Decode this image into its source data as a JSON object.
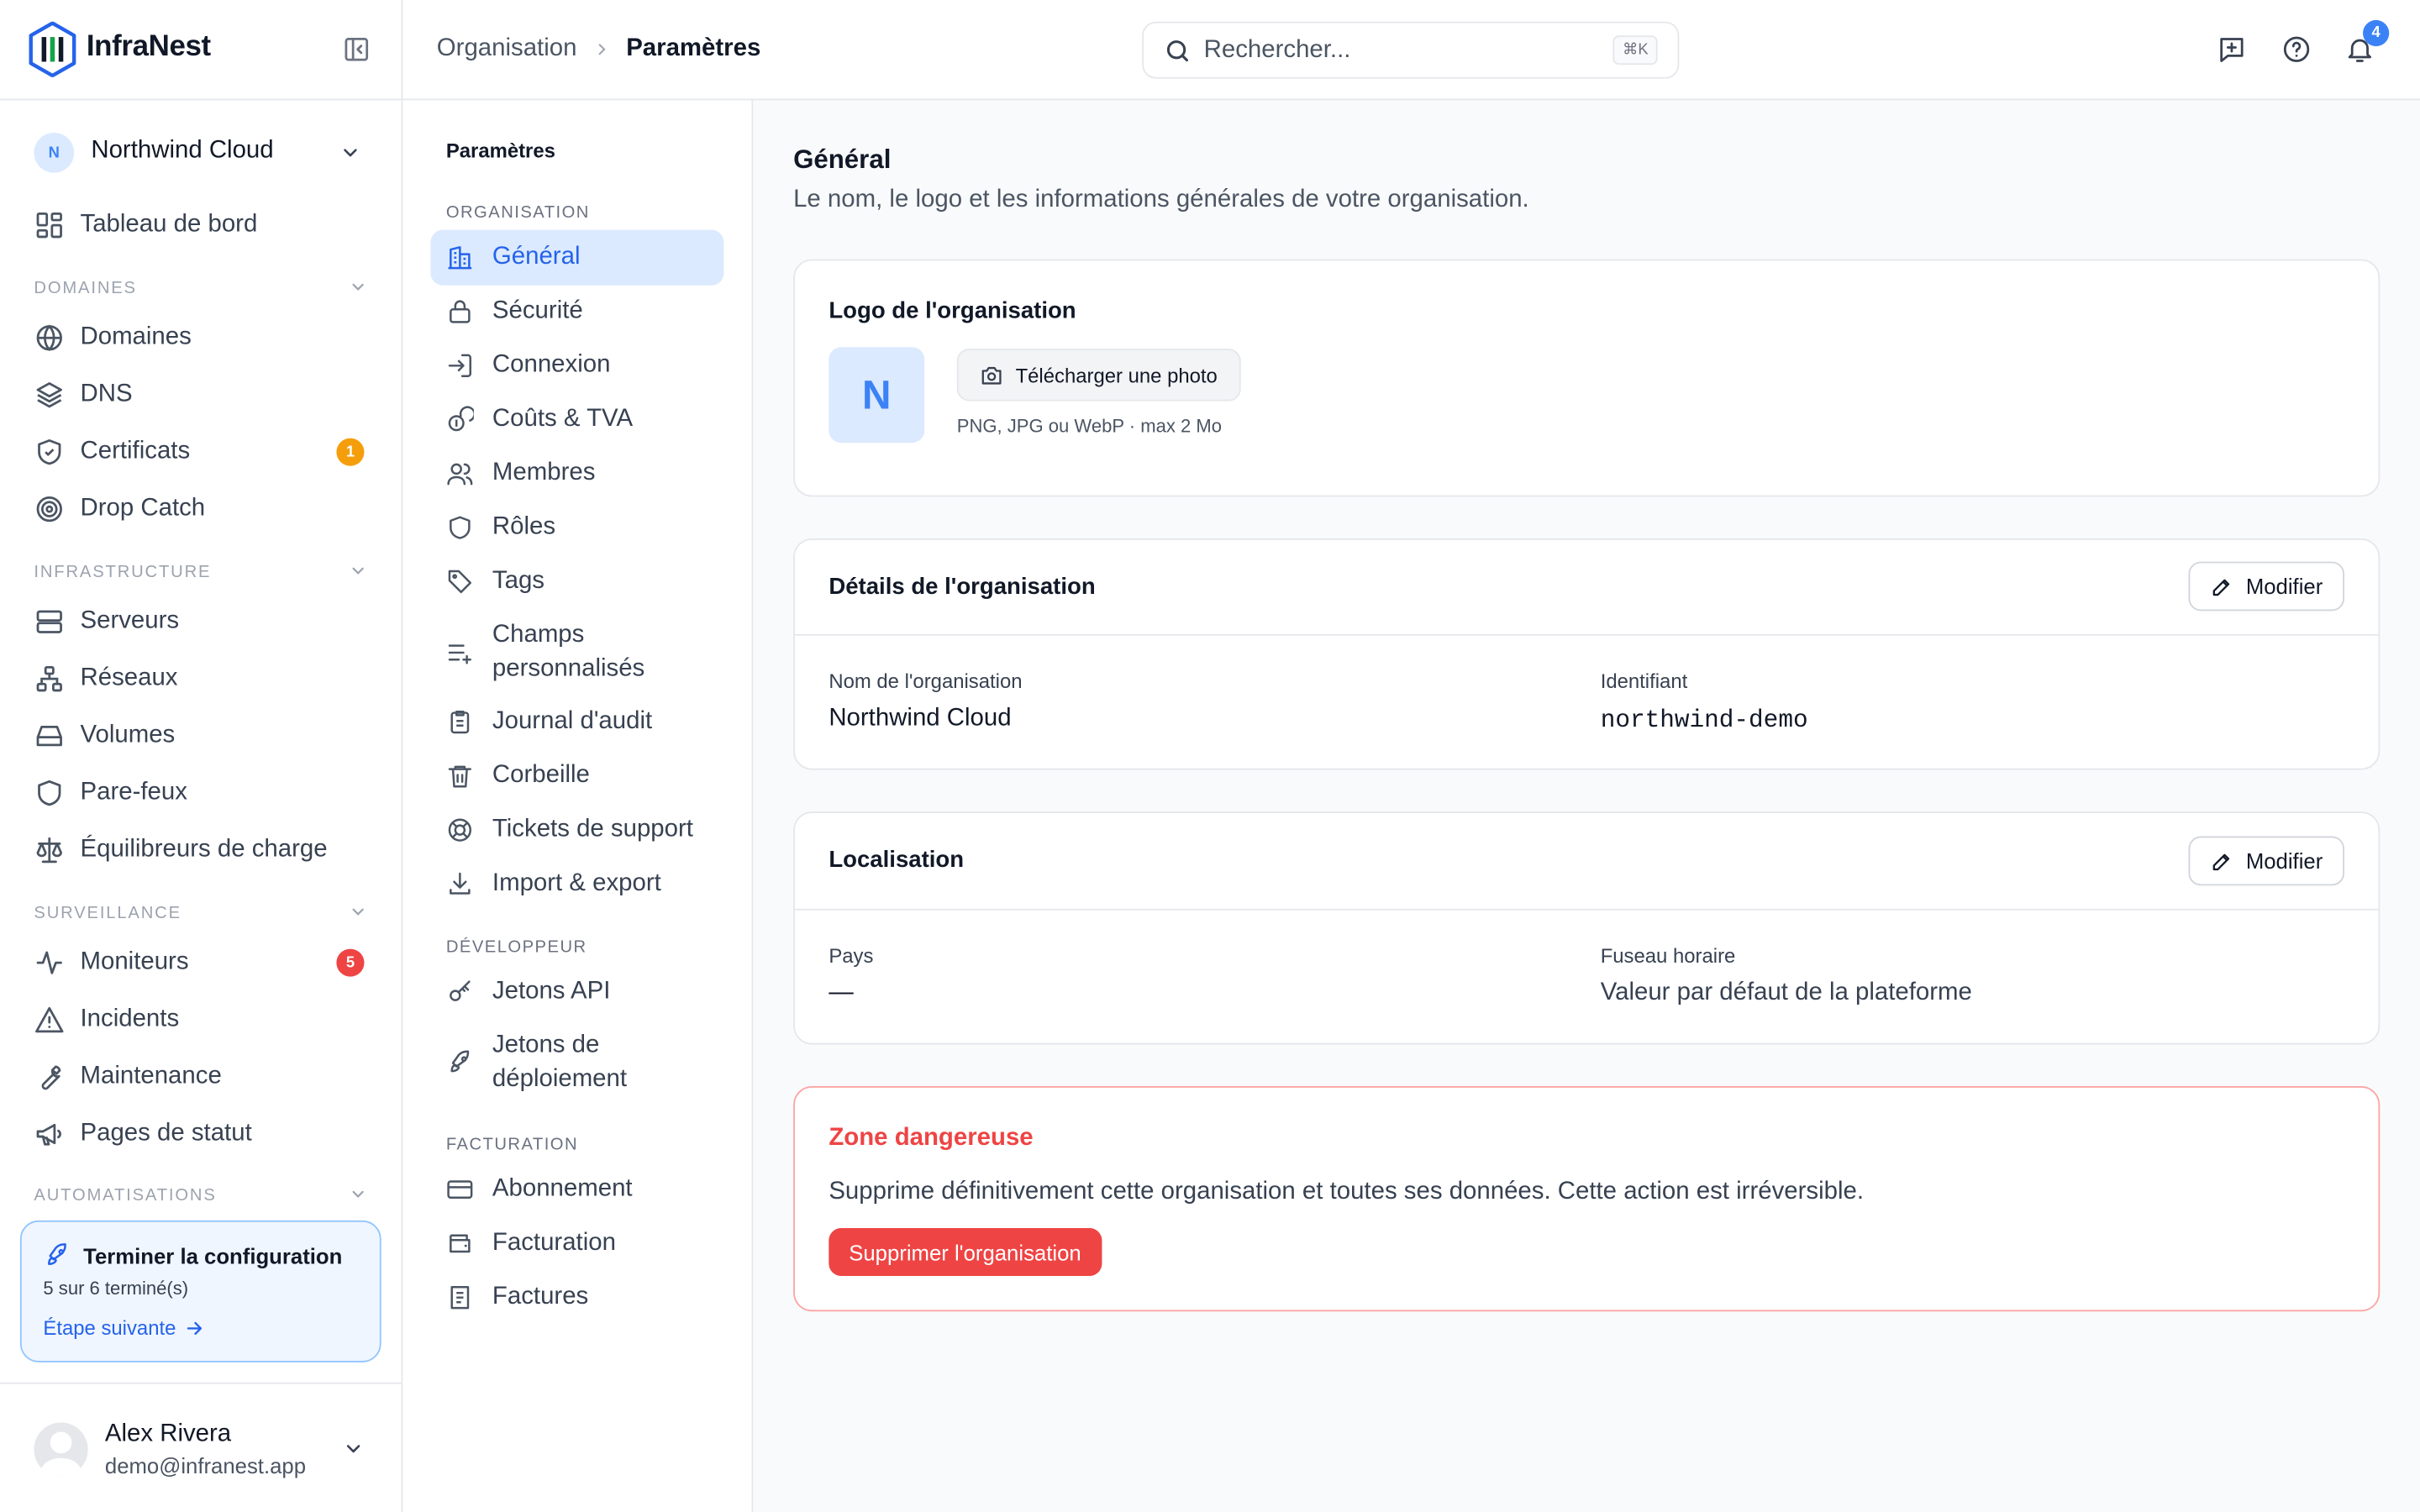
{
  "brand": {
    "name": "InfraNest"
  },
  "org": {
    "initial": "N",
    "name": "Northwind Cloud"
  },
  "sidebar": {
    "dashboard": "Tableau de bord",
    "sections": [
      {
        "title": "DOMAINES",
        "items": [
          {
            "label": "Domaines",
            "icon": "globe-icon"
          },
          {
            "label": "DNS",
            "icon": "layers-icon"
          },
          {
            "label": "Certificats",
            "icon": "shield-check-icon",
            "badge": "1",
            "badge_color": "#f59e0b"
          },
          {
            "label": "Drop Catch",
            "icon": "target-icon"
          }
        ]
      },
      {
        "title": "INFRASTRUCTURE",
        "items": [
          {
            "label": "Serveurs",
            "icon": "server-icon"
          },
          {
            "label": "Réseaux",
            "icon": "network-icon"
          },
          {
            "label": "Volumes",
            "icon": "hard-drive-icon"
          },
          {
            "label": "Pare-feux",
            "icon": "shield-icon"
          },
          {
            "label": "Équilibreurs de charge",
            "icon": "scale-icon"
          }
        ]
      },
      {
        "title": "SURVEILLANCE",
        "items": [
          {
            "label": "Moniteurs",
            "icon": "activity-icon",
            "badge": "5",
            "badge_color": "#ef4444"
          },
          {
            "label": "Incidents",
            "icon": "alert-triangle-icon"
          },
          {
            "label": "Maintenance",
            "icon": "wrench-icon"
          },
          {
            "label": "Pages de statut",
            "icon": "megaphone-icon"
          }
        ]
      },
      {
        "title": "AUTOMATISATIONS",
        "items": []
      }
    ],
    "setup": {
      "title": "Terminer la configuration",
      "progress": "5 sur 6 terminé(s)",
      "next": "Étape suivante"
    },
    "user": {
      "name": "Alex Rivera",
      "email": "demo@infranest.app"
    }
  },
  "topbar": {
    "breadcrumb": [
      "Organisation",
      "Paramètres"
    ],
    "search_placeholder": "Rechercher...",
    "search_shortcut": "⌘K",
    "notifications_count": "4"
  },
  "settings_nav": {
    "title": "Paramètres",
    "sections": [
      {
        "title": "ORGANISATION",
        "items": [
          {
            "label": "Général",
            "icon": "building-icon",
            "active": true
          },
          {
            "label": "Sécurité",
            "icon": "lock-icon"
          },
          {
            "label": "Connexion",
            "icon": "log-in-icon"
          },
          {
            "label": "Coûts & TVA",
            "icon": "coins-icon"
          },
          {
            "label": "Membres",
            "icon": "users-icon"
          },
          {
            "label": "Rôles",
            "icon": "shield-icon"
          },
          {
            "label": "Tags",
            "icon": "tag-icon"
          },
          {
            "label": "Champs personnalisés",
            "icon": "list-plus-icon"
          },
          {
            "label": "Journal d'audit",
            "icon": "clipboard-icon"
          },
          {
            "label": "Corbeille",
            "icon": "trash-icon"
          },
          {
            "label": "Tickets de support",
            "icon": "life-buoy-icon"
          },
          {
            "label": "Import & export",
            "icon": "download-icon"
          }
        ]
      },
      {
        "title": "DÉVELOPPEUR",
        "items": [
          {
            "label": "Jetons API",
            "icon": "key-icon"
          },
          {
            "label": "Jetons de déploiement",
            "icon": "rocket-icon"
          }
        ]
      },
      {
        "title": "FACTURATION",
        "items": [
          {
            "label": "Abonnement",
            "icon": "credit-card-icon"
          },
          {
            "label": "Facturation",
            "icon": "wallet-icon"
          },
          {
            "label": "Factures",
            "icon": "receipt-icon"
          }
        ]
      }
    ]
  },
  "main": {
    "title": "Général",
    "subtitle": "Le nom, le logo et les informations générales de votre organisation.",
    "logo_card": {
      "title": "Logo de l'organisation",
      "initial": "N",
      "upload_label": "Télécharger une photo",
      "hint": "PNG, JPG ou WebP · max 2 Mo"
    },
    "details_card": {
      "title": "Détails de l'organisation",
      "edit_label": "Modifier",
      "fields": [
        {
          "label": "Nom de l'organisation",
          "value": "Northwind Cloud"
        },
        {
          "label": "Identifiant",
          "value": "northwind-demo"
        }
      ]
    },
    "locale_card": {
      "title": "Localisation",
      "edit_label": "Modifier",
      "fields": [
        {
          "label": "Pays",
          "value": "—"
        },
        {
          "label": "Fuseau horaire",
          "value": "Valeur par défaut de la plateforme"
        }
      ]
    },
    "danger_card": {
      "title": "Zone dangereuse",
      "text": "Supprime définitivement cette organisation et toutes ses données. Cette action est irréversible.",
      "button": "Supprimer l'organisation"
    }
  },
  "colors": {
    "accent": "#2563eb",
    "accent_light": "#dbeafe",
    "danger": "#ef4444"
  }
}
